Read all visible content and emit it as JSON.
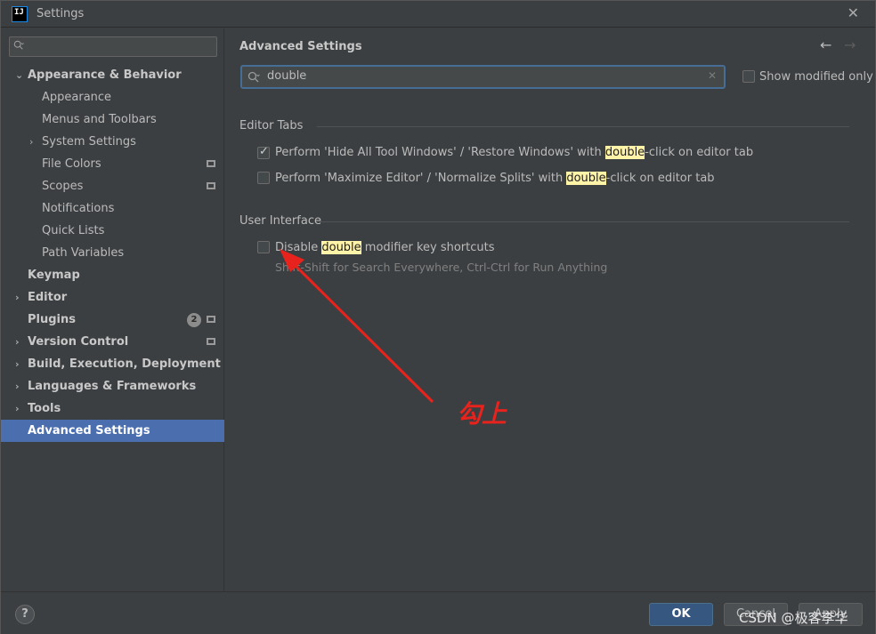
{
  "window": {
    "title": "Settings",
    "app_icon_text_top": "IJ",
    "close_glyph": "✕"
  },
  "sidebar": {
    "search_placeholder": "",
    "items": [
      {
        "label": "Appearance & Behavior",
        "level": 0,
        "bold": true,
        "expanded": true,
        "chevron": "⌄"
      },
      {
        "label": "Appearance",
        "level": 1
      },
      {
        "label": "Menus and Toolbars",
        "level": 1
      },
      {
        "label": "System Settings",
        "level": 1,
        "chevron": "›"
      },
      {
        "label": "File Colors",
        "level": 1,
        "doc_icon": true
      },
      {
        "label": "Scopes",
        "level": 1,
        "doc_icon": true
      },
      {
        "label": "Notifications",
        "level": 1
      },
      {
        "label": "Quick Lists",
        "level": 1
      },
      {
        "label": "Path Variables",
        "level": 1
      },
      {
        "label": "Keymap",
        "level": 0,
        "bold": true
      },
      {
        "label": "Editor",
        "level": 0,
        "bold": true,
        "chevron": "›"
      },
      {
        "label": "Plugins",
        "level": 0,
        "bold": true,
        "badge": "2",
        "doc_icon": true
      },
      {
        "label": "Version Control",
        "level": 0,
        "bold": true,
        "chevron": "›",
        "doc_icon": true
      },
      {
        "label": "Build, Execution, Deployment",
        "level": 0,
        "bold": true,
        "chevron": "›"
      },
      {
        "label": "Languages & Frameworks",
        "level": 0,
        "bold": true,
        "chevron": "›"
      },
      {
        "label": "Tools",
        "level": 0,
        "bold": true,
        "chevron": "›"
      },
      {
        "label": "Advanced Settings",
        "level": 0,
        "bold": true,
        "selected": true
      }
    ]
  },
  "content": {
    "title": "Advanced Settings",
    "back_glyph": "←",
    "forward_glyph": "→",
    "search_value": "double",
    "search_clear_glyph": "✕",
    "show_modified_label": "Show modified only",
    "show_modified_checked": false,
    "sections": {
      "editor_tabs": {
        "title": "Editor Tabs",
        "opt1": {
          "checked": true,
          "pre": "Perform 'Hide All Tool Windows' / 'Restore Windows' with ",
          "hl": "double",
          "post": "-click on editor tab"
        },
        "opt2": {
          "checked": false,
          "pre": "Perform 'Maximize Editor' / 'Normalize Splits' with ",
          "hl": "double",
          "post": "-click on editor tab"
        }
      },
      "user_interface": {
        "title": "User Interface",
        "opt1": {
          "checked": false,
          "pre": "Disable ",
          "hl": "double",
          "post": " modifier key shortcuts",
          "hint": "Shift-Shift for Search Everywhere, Ctrl-Ctrl for Run Anything"
        }
      }
    }
  },
  "annotation": {
    "text": "勾上",
    "color": "#e8221c"
  },
  "footer": {
    "help_glyph": "?",
    "ok_label": "OK",
    "cancel_label": "Cancel",
    "apply_label": "Apply",
    "watermark": "CSDN @极客李华"
  },
  "colors": {
    "background": "#3c3f41",
    "selection": "#4b6eaf",
    "highlight": "#fff3a8",
    "ok_button": "#365880"
  }
}
